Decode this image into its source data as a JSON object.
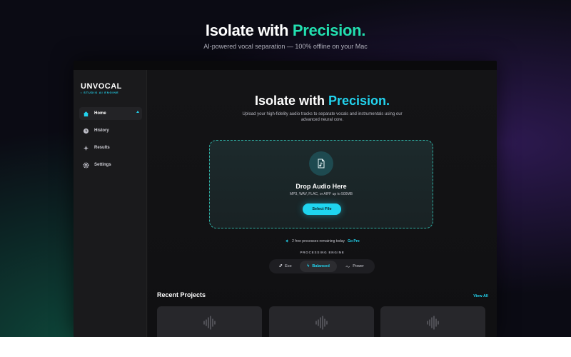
{
  "hero": {
    "title_main": "Isolate with ",
    "title_accent": "Precision.",
    "subtitle": "AI-powered vocal separation — 100% offline on your Mac"
  },
  "sidebar": {
    "logo": "UNVOCAL",
    "logo_sub": "• STUDIO AI ENGINE",
    "items": [
      {
        "label": "Home",
        "icon": "home-icon",
        "active": true
      },
      {
        "label": "History",
        "icon": "clock-icon"
      },
      {
        "label": "Results",
        "icon": "sparkle-icon"
      },
      {
        "label": "Settings",
        "icon": "gear-icon"
      }
    ]
  },
  "main": {
    "title_main": "Isolate with ",
    "title_accent": "Precision.",
    "subtitle": "Upload your high-fidelity audio tracks to separate vocals and instrumentals using our advanced neural core.",
    "dropzone": {
      "title": "Drop Audio Here",
      "subtitle": "MP3, WAV, FLAC, or AIFF up to 500MB",
      "button": "Select File"
    },
    "remaining": "2 free processes remaining today",
    "go_pro": "Go Pro",
    "engine_label": "PROCESSING ENGINE",
    "engine_options": [
      {
        "label": "Eco",
        "icon": "leaf-icon"
      },
      {
        "label": "Balanced",
        "icon": "bolt-icon",
        "selected": true
      },
      {
        "label": "Power",
        "icon": "wave-icon"
      }
    ],
    "recent_title": "Recent Projects",
    "view_all": "View All"
  },
  "colors": {
    "accent_green": "#22e0b0",
    "accent_cyan": "#22d3ee",
    "background": "#0b0b14",
    "panel": "#141416"
  }
}
